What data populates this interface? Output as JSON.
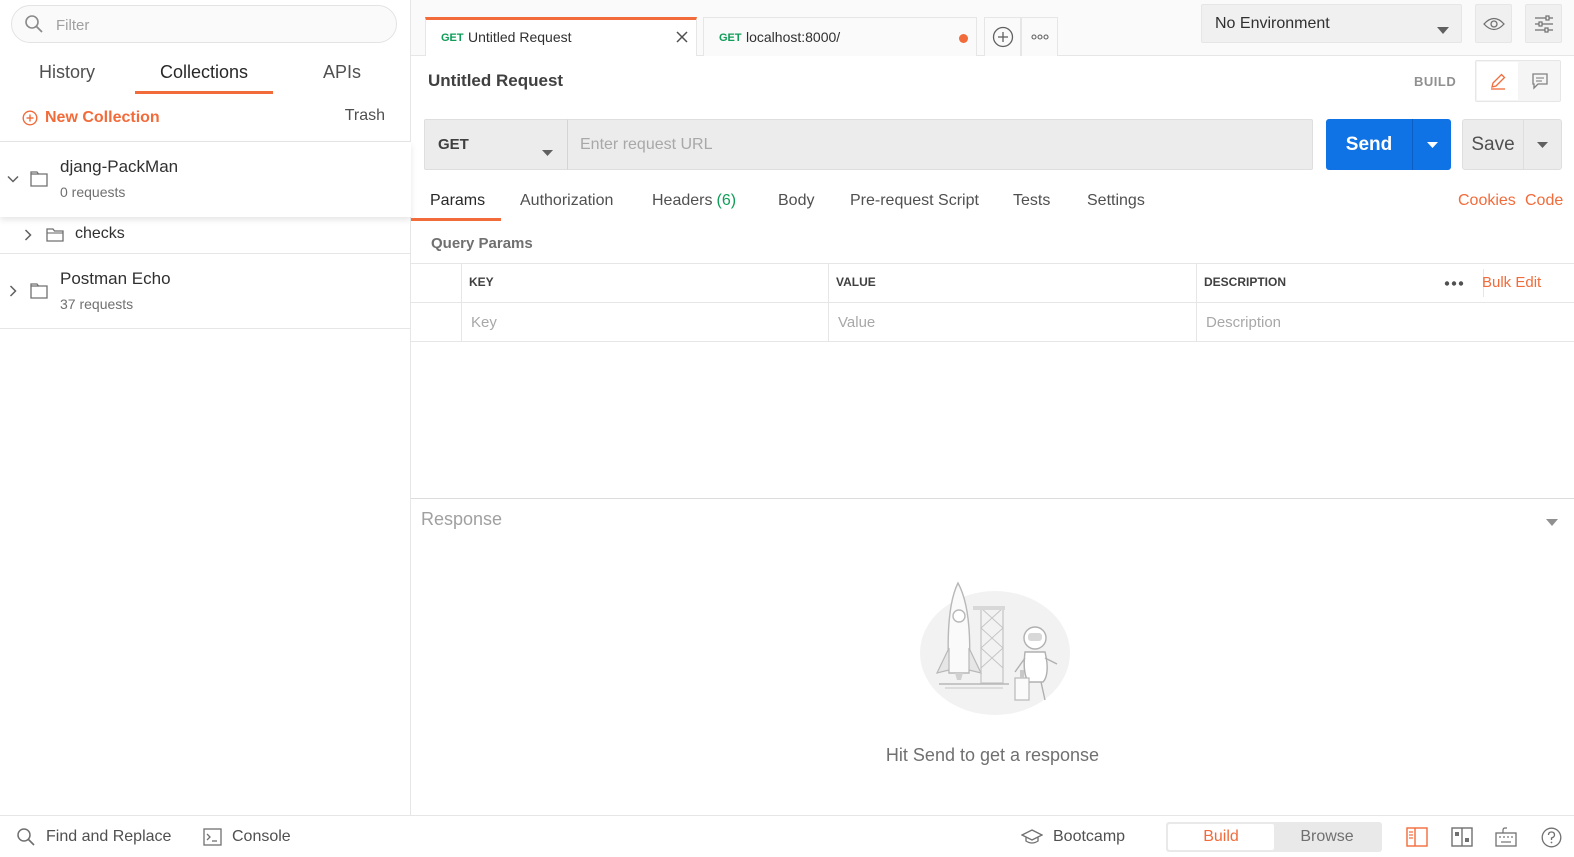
{
  "sidebar": {
    "filter_placeholder": "Filter",
    "tabs": [
      {
        "label": "History"
      },
      {
        "label": "Collections"
      },
      {
        "label": "APIs"
      }
    ],
    "new_collection_label": "New Collection",
    "trash_label": "Trash",
    "collections": [
      {
        "name": "djang-PackMan",
        "count": "0 requests",
        "expanded": true,
        "children": [
          {
            "name": "checks"
          }
        ]
      },
      {
        "name": "Postman Echo",
        "count": "37 requests",
        "expanded": false
      }
    ]
  },
  "tabbar": {
    "tabs": [
      {
        "method": "GET",
        "name": "Untitled Request",
        "active": true
      },
      {
        "method": "GET",
        "name": "localhost:8000/",
        "unsaved": true
      }
    ],
    "environment": "No Environment"
  },
  "request": {
    "title": "Untitled Request",
    "mode_label": "BUILD",
    "method": "GET",
    "url_placeholder": "Enter request URL",
    "send_label": "Send",
    "save_label": "Save",
    "tabs": [
      {
        "label": "Params"
      },
      {
        "label": "Authorization"
      },
      {
        "label": "Headers",
        "count": "(6)"
      },
      {
        "label": "Body"
      },
      {
        "label": "Pre-request Script"
      },
      {
        "label": "Tests"
      },
      {
        "label": "Settings"
      }
    ],
    "cookies_label": "Cookies",
    "code_label": "Code",
    "query_params_title": "Query Params",
    "params_table": {
      "headers": [
        "KEY",
        "VALUE",
        "DESCRIPTION"
      ],
      "placeholders": [
        "Key",
        "Value",
        "Description"
      ],
      "bulk_edit_label": "Bulk Edit"
    }
  },
  "response": {
    "title": "Response",
    "hint": "Hit Send to get a response"
  },
  "footer": {
    "find_replace": "Find and Replace",
    "console": "Console",
    "bootcamp": "Bootcamp",
    "build": "Build",
    "browse": "Browse"
  },
  "colors": {
    "accent": "#f26b3a",
    "send_blue": "#0f73e6",
    "method_green": "#0f9d58"
  }
}
